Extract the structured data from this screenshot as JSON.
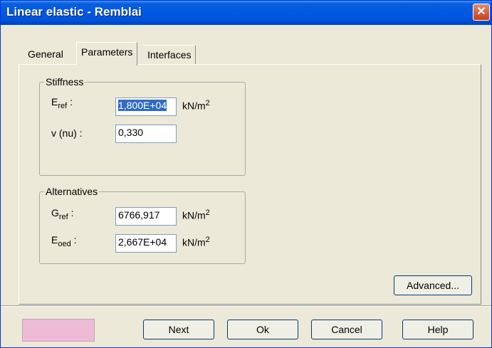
{
  "window": {
    "title": "Linear elastic - Remblai",
    "close": "✕"
  },
  "tabs": [
    "General",
    "Parameters",
    "Interfaces"
  ],
  "stiffness": {
    "legend": "Stiffness",
    "e_ref": {
      "label": "E",
      "sub": "ref",
      "value": "1,800E+04",
      "unit": "kN/m",
      "unit_sup": "2"
    },
    "nu": {
      "label": "v (nu) :",
      "value": "0,330"
    }
  },
  "alternatives": {
    "legend": "Alternatives",
    "g_ref": {
      "label": "G",
      "sub": "ref",
      "value": "6766,917",
      "unit": "kN/m",
      "unit_sup": "2"
    },
    "e_oed": {
      "label": "E",
      "sub": "oed",
      "value": "2,667E+04",
      "unit": "kN/m",
      "unit_sup": "2"
    }
  },
  "buttons": {
    "advanced": "Advanced...",
    "next": "Next",
    "ok": "Ok",
    "cancel": "Cancel",
    "help": "Help"
  },
  "colors": {
    "titlebar": "#0058e6",
    "swatch": "#eebbd6",
    "selection": "#316ac5"
  }
}
